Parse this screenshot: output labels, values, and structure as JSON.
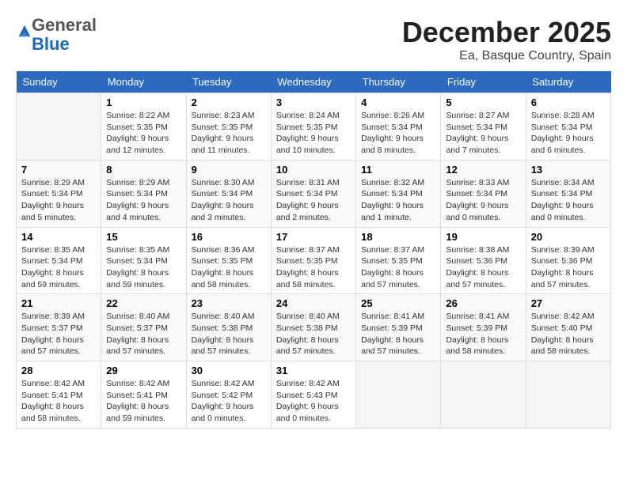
{
  "logo": {
    "general": "General",
    "blue": "Blue"
  },
  "title": "December 2025",
  "location": "Ea, Basque Country, Spain",
  "days_of_week": [
    "Sunday",
    "Monday",
    "Tuesday",
    "Wednesday",
    "Thursday",
    "Friday",
    "Saturday"
  ],
  "weeks": [
    [
      {
        "day": "",
        "info": ""
      },
      {
        "day": "1",
        "info": "Sunrise: 8:22 AM\nSunset: 5:35 PM\nDaylight: 9 hours\nand 12 minutes."
      },
      {
        "day": "2",
        "info": "Sunrise: 8:23 AM\nSunset: 5:35 PM\nDaylight: 9 hours\nand 11 minutes."
      },
      {
        "day": "3",
        "info": "Sunrise: 8:24 AM\nSunset: 5:35 PM\nDaylight: 9 hours\nand 10 minutes."
      },
      {
        "day": "4",
        "info": "Sunrise: 8:26 AM\nSunset: 5:34 PM\nDaylight: 9 hours\nand 8 minutes."
      },
      {
        "day": "5",
        "info": "Sunrise: 8:27 AM\nSunset: 5:34 PM\nDaylight: 9 hours\nand 7 minutes."
      },
      {
        "day": "6",
        "info": "Sunrise: 8:28 AM\nSunset: 5:34 PM\nDaylight: 9 hours\nand 6 minutes."
      }
    ],
    [
      {
        "day": "7",
        "info": "Sunrise: 8:29 AM\nSunset: 5:34 PM\nDaylight: 9 hours\nand 5 minutes."
      },
      {
        "day": "8",
        "info": "Sunrise: 8:29 AM\nSunset: 5:34 PM\nDaylight: 9 hours\nand 4 minutes."
      },
      {
        "day": "9",
        "info": "Sunrise: 8:30 AM\nSunset: 5:34 PM\nDaylight: 9 hours\nand 3 minutes."
      },
      {
        "day": "10",
        "info": "Sunrise: 8:31 AM\nSunset: 5:34 PM\nDaylight: 9 hours\nand 2 minutes."
      },
      {
        "day": "11",
        "info": "Sunrise: 8:32 AM\nSunset: 5:34 PM\nDaylight: 9 hours\nand 1 minute."
      },
      {
        "day": "12",
        "info": "Sunrise: 8:33 AM\nSunset: 5:34 PM\nDaylight: 9 hours\nand 0 minutes."
      },
      {
        "day": "13",
        "info": "Sunrise: 8:34 AM\nSunset: 5:34 PM\nDaylight: 9 hours\nand 0 minutes."
      }
    ],
    [
      {
        "day": "14",
        "info": "Sunrise: 8:35 AM\nSunset: 5:34 PM\nDaylight: 8 hours\nand 59 minutes."
      },
      {
        "day": "15",
        "info": "Sunrise: 8:35 AM\nSunset: 5:34 PM\nDaylight: 8 hours\nand 59 minutes."
      },
      {
        "day": "16",
        "info": "Sunrise: 8:36 AM\nSunset: 5:35 PM\nDaylight: 8 hours\nand 58 minutes."
      },
      {
        "day": "17",
        "info": "Sunrise: 8:37 AM\nSunset: 5:35 PM\nDaylight: 8 hours\nand 58 minutes."
      },
      {
        "day": "18",
        "info": "Sunrise: 8:37 AM\nSunset: 5:35 PM\nDaylight: 8 hours\nand 57 minutes."
      },
      {
        "day": "19",
        "info": "Sunrise: 8:38 AM\nSunset: 5:36 PM\nDaylight: 8 hours\nand 57 minutes."
      },
      {
        "day": "20",
        "info": "Sunrise: 8:39 AM\nSunset: 5:36 PM\nDaylight: 8 hours\nand 57 minutes."
      }
    ],
    [
      {
        "day": "21",
        "info": "Sunrise: 8:39 AM\nSunset: 5:37 PM\nDaylight: 8 hours\nand 57 minutes."
      },
      {
        "day": "22",
        "info": "Sunrise: 8:40 AM\nSunset: 5:37 PM\nDaylight: 8 hours\nand 57 minutes."
      },
      {
        "day": "23",
        "info": "Sunrise: 8:40 AM\nSunset: 5:38 PM\nDaylight: 8 hours\nand 57 minutes."
      },
      {
        "day": "24",
        "info": "Sunrise: 8:40 AM\nSunset: 5:38 PM\nDaylight: 8 hours\nand 57 minutes."
      },
      {
        "day": "25",
        "info": "Sunrise: 8:41 AM\nSunset: 5:39 PM\nDaylight: 8 hours\nand 57 minutes."
      },
      {
        "day": "26",
        "info": "Sunrise: 8:41 AM\nSunset: 5:39 PM\nDaylight: 8 hours\nand 58 minutes."
      },
      {
        "day": "27",
        "info": "Sunrise: 8:42 AM\nSunset: 5:40 PM\nDaylight: 8 hours\nand 58 minutes."
      }
    ],
    [
      {
        "day": "28",
        "info": "Sunrise: 8:42 AM\nSunset: 5:41 PM\nDaylight: 8 hours\nand 58 minutes."
      },
      {
        "day": "29",
        "info": "Sunrise: 8:42 AM\nSunset: 5:41 PM\nDaylight: 8 hours\nand 59 minutes."
      },
      {
        "day": "30",
        "info": "Sunrise: 8:42 AM\nSunset: 5:42 PM\nDaylight: 9 hours\nand 0 minutes."
      },
      {
        "day": "31",
        "info": "Sunrise: 8:42 AM\nSunset: 5:43 PM\nDaylight: 9 hours\nand 0 minutes."
      },
      {
        "day": "",
        "info": ""
      },
      {
        "day": "",
        "info": ""
      },
      {
        "day": "",
        "info": ""
      }
    ]
  ]
}
